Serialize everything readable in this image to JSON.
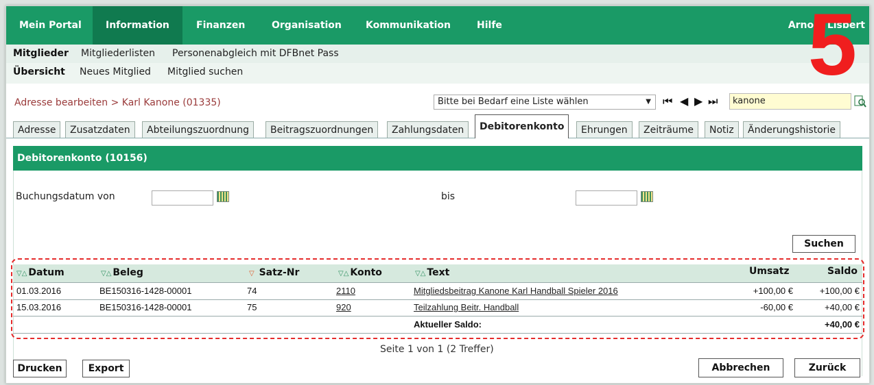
{
  "nav": {
    "items": [
      "Mein Portal",
      "Information",
      "Finanzen",
      "Organisation",
      "Kommunikation",
      "Hilfe"
    ],
    "active": "Information",
    "user": "Arnold Lisbert"
  },
  "overlay": {
    "number": "5"
  },
  "subnav1": {
    "items": [
      "Mitglieder",
      "Mitgliederlisten",
      "Personenabgleich mit DFBnet Pass"
    ]
  },
  "subnav2": {
    "items": [
      "Übersicht",
      "Neues Mitglied",
      "Mitglied suchen"
    ]
  },
  "breadcrumb": "Adresse bearbeiten > Karl Kanone (01335)",
  "list_select": {
    "value": "Bitte bei Bedarf eine Liste wählen"
  },
  "pager": {
    "first": "⏮",
    "prev": "◀",
    "next": "▶",
    "last": "⏭"
  },
  "search": {
    "value": "kanone"
  },
  "tabs": [
    "Adresse",
    "Zusatzdaten",
    "Abteilungszuordnung",
    "Beitragszuordnungen",
    "Zahlungsdaten",
    "Debitorenkonto",
    "Ehrungen",
    "Zeiträume",
    "Notiz",
    "Änderungshistorie"
  ],
  "active_tab": "Debitorenkonto",
  "panel": {
    "title": "Debitorenkonto  (10156)"
  },
  "filter": {
    "from_label": "Buchungsdatum von",
    "to_label": "bis",
    "from_value": "",
    "to_value": "",
    "search_button": "Suchen"
  },
  "table": {
    "headers": {
      "datum": "Datum",
      "beleg": "Beleg",
      "satz": "Satz-Nr",
      "konto": "Konto",
      "text": "Text",
      "umsatz": "Umsatz",
      "saldo": "Saldo"
    },
    "rows": [
      {
        "datum": "01.03.2016",
        "beleg": "BE150316-1428-00001",
        "satz": "74",
        "konto": "2110",
        "text": "Mitgliedsbeitrag Kanone Karl Handball Spieler 2016",
        "umsatz": "+100,00 €",
        "saldo": "+100,00 €"
      },
      {
        "datum": "15.03.2016",
        "beleg": "BE150316-1428-00001",
        "satz": "75",
        "konto": "920",
        "text": "Teilzahlung Beitr. Handball",
        "umsatz": "-60,00 €",
        "saldo": "+40,00 €"
      }
    ],
    "total_label": "Aktueller Saldo:",
    "total_value": "+40,00 €"
  },
  "pageinfo": "Seite 1 von 1 (2 Treffer)",
  "buttons": {
    "print": "Drucken",
    "export": "Export",
    "cancel": "Abbrechen",
    "back": "Zurück"
  },
  "colors": {
    "brand_green": "#1a9a66",
    "active_nav": "#107a4f",
    "highlight": "#e52b2b"
  }
}
